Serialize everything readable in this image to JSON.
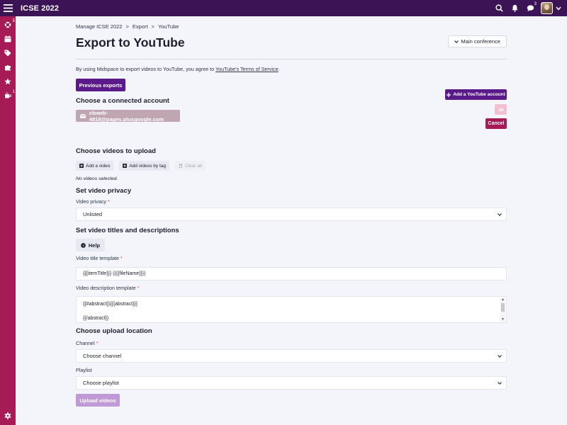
{
  "app": {
    "title": "ICSE 2022"
  },
  "topbar": {
    "chat_badge": "3"
  },
  "sidebar": {
    "items": [
      {
        "icon": "life-ring-icon",
        "badge": "5"
      },
      {
        "icon": "calendar-icon",
        "badge": ""
      },
      {
        "icon": "tags-icon",
        "badge": ""
      },
      {
        "icon": "puzzle-icon",
        "badge": ""
      },
      {
        "icon": "star-icon",
        "badge": ""
      },
      {
        "icon": "coffee-icon",
        "badge": "1"
      }
    ]
  },
  "breadcrumb": {
    "items": [
      "Manage ICSE 2022",
      ">",
      "Export",
      ">",
      "YouTube"
    ]
  },
  "page": {
    "title": "Export to YouTube",
    "main_conference": "Main conference",
    "terms_prefix": "By using Midspace to export videos to YouTube, you agree to ",
    "terms_link": "YouTube's Terms of Service",
    "terms_suffix": ".",
    "previous_exports": "Previous exports"
  },
  "account": {
    "section_title": "Choose a connected account",
    "add_button": "Add a YouTube account",
    "connected_email": "clowdr-4818@pages.plusgoogle.com",
    "cancel": "Cancel"
  },
  "videos": {
    "section_title": "Choose videos to upload",
    "add_video": "Add a video",
    "add_by_tag": "Add videos by tag",
    "clear_all": "Clear all",
    "none_selected": "No videos selected."
  },
  "privacy": {
    "section_title": "Set video privacy",
    "label": "Video privacy",
    "required": "*",
    "value": "Unlisted"
  },
  "titles": {
    "section_title": "Set video titles and descriptions",
    "help": "Help",
    "title_label": "Video title template",
    "title_value": "{{{itemTitle}}} ({{{fileName}}})",
    "desc_label": "Video description template",
    "desc_line1": "{{#abstract}}{{{abstract}}}",
    "desc_line2": "{{/abstract}}"
  },
  "location": {
    "section_title": "Choose upload location",
    "channel_label": "Channel",
    "channel_value": "Choose channel",
    "playlist_label": "Playlist",
    "playlist_value": "Choose playlist"
  },
  "upload": {
    "label": "Upload videos"
  },
  "colors": {
    "topbar": "#3c1456",
    "sidebar": "#a61a55",
    "primary_button": "#5a1a8a",
    "cancel_button": "#a61a55"
  }
}
